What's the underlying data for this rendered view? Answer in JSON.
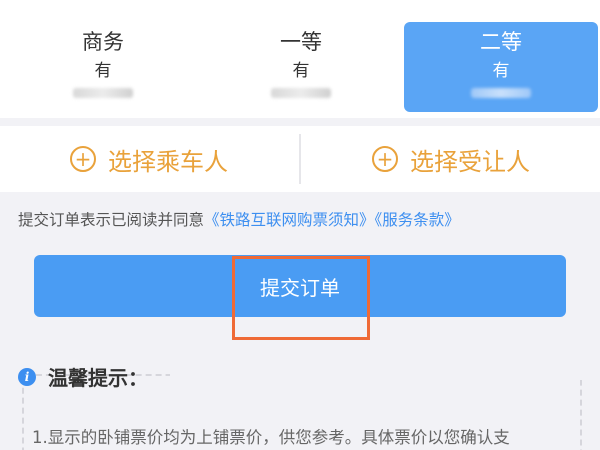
{
  "seats": [
    {
      "name": "商务",
      "availability": "有",
      "selected": false
    },
    {
      "name": "一等",
      "availability": "有",
      "selected": false
    },
    {
      "name": "二等",
      "availability": "有",
      "selected": true
    }
  ],
  "passenger": {
    "select_passenger_label": "选择乘车人",
    "select_recipient_label": "选择受让人"
  },
  "agreement": {
    "prefix": "提交订单表示已阅读并同意",
    "link_notice": "《铁路互联网购票须知》",
    "link_terms": "《服务条款》"
  },
  "submit": {
    "label": "提交订单"
  },
  "tips": {
    "title": "温馨提示：",
    "item1": "1.显示的卧铺票价均为上铺票价，供您参考。具体票价以您确认支"
  },
  "colors": {
    "accent_blue": "#4a9cf3",
    "orange": "#e9a23b",
    "highlight": "#ef6a36"
  }
}
